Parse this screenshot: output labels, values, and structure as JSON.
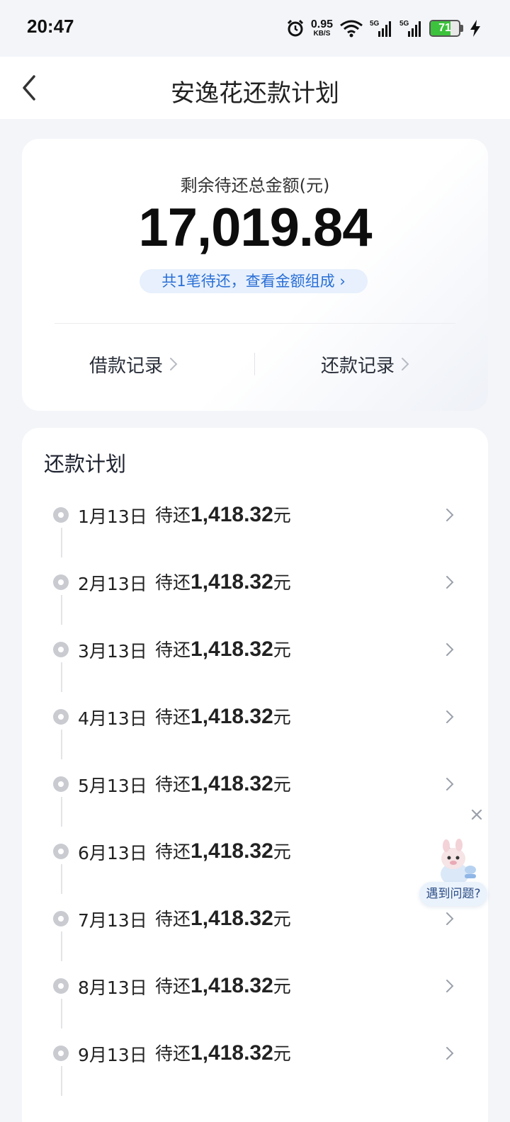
{
  "status_bar": {
    "time": "20:47",
    "net_speed_value": "0.95",
    "net_speed_unit": "KB/S",
    "signal_label_1": "5G",
    "signal_label_2": "5G",
    "battery": "71",
    "battery_level": 0.71,
    "battery_color": "#3cc23c"
  },
  "nav": {
    "title": "安逸花还款计划"
  },
  "summary": {
    "label": "剩余待还总金额(元)",
    "amount": "17,019.84",
    "detail_link": "共1笔待还，查看金额组成 ›",
    "borrow_records": "借款记录",
    "repay_records": "还款记录"
  },
  "plan": {
    "title": "还款计划",
    "rows": [
      {
        "date": "1月13日",
        "prefix": "待还",
        "amount": "1,418.32",
        "unit": "元"
      },
      {
        "date": "2月13日",
        "prefix": "待还",
        "amount": "1,418.32",
        "unit": "元"
      },
      {
        "date": "3月13日",
        "prefix": "待还",
        "amount": "1,418.32",
        "unit": "元"
      },
      {
        "date": "4月13日",
        "prefix": "待还",
        "amount": "1,418.32",
        "unit": "元"
      },
      {
        "date": "5月13日",
        "prefix": "待还",
        "amount": "1,418.32",
        "unit": "元"
      },
      {
        "date": "6月13日",
        "prefix": "待还",
        "amount": "1,418.32",
        "unit": "元"
      },
      {
        "date": "7月13日",
        "prefix": "待还",
        "amount": "1,418.32",
        "unit": "元"
      },
      {
        "date": "8月13日",
        "prefix": "待还",
        "amount": "1,418.32",
        "unit": "元"
      },
      {
        "date": "9月13日",
        "prefix": "待还",
        "amount": "1,418.32",
        "unit": "元"
      }
    ]
  },
  "helper": {
    "label": "遇到问题?"
  },
  "colors": {
    "accent_blue": "#2a6fd6",
    "page_bg": "#f3f5f9"
  }
}
